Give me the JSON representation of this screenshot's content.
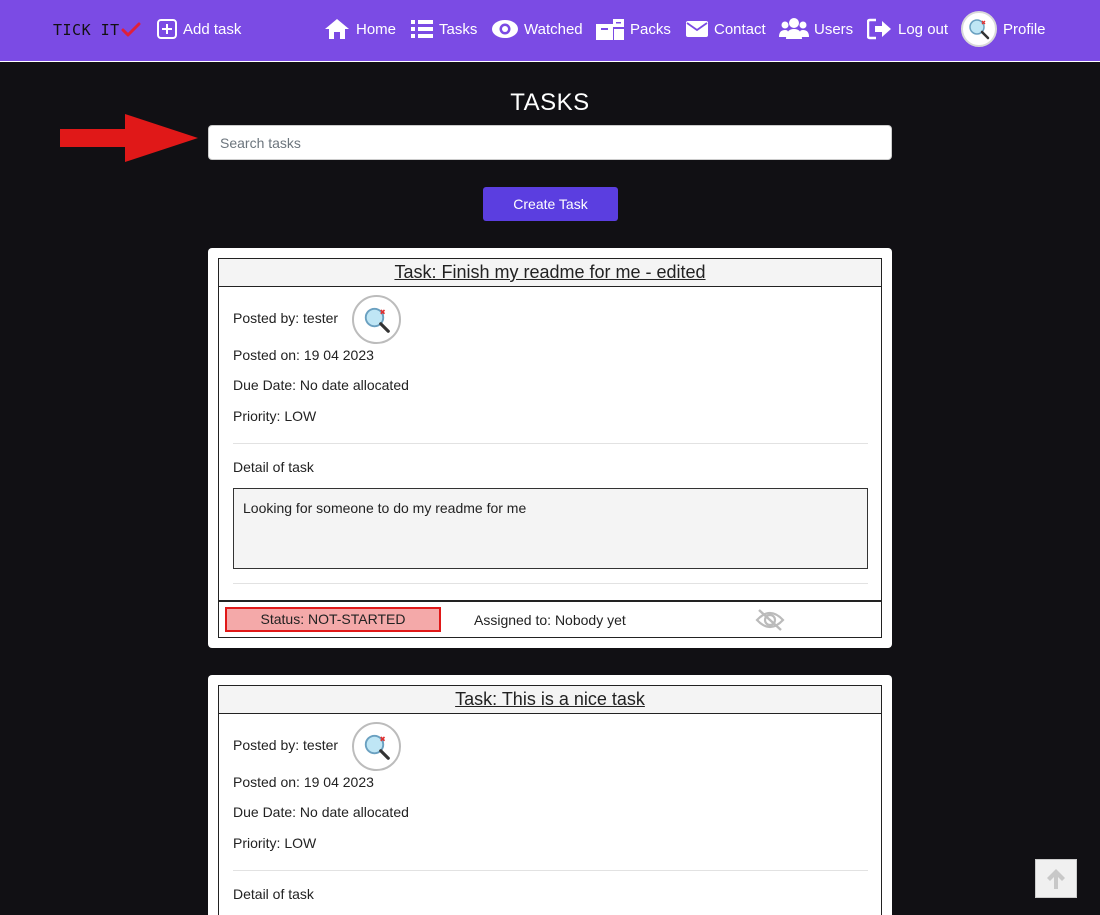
{
  "nav": {
    "brand": "TICK IT",
    "add_task": "Add task",
    "home": "Home",
    "tasks": "Tasks",
    "watched": "Watched",
    "packs": "Packs",
    "contact": "Contact",
    "users": "Users",
    "logout": "Log out",
    "profile": "Profile"
  },
  "page": {
    "title": "TASKS",
    "search_placeholder": "Search tasks",
    "create_button": "Create Task"
  },
  "tasks": [
    {
      "title": "Task: Finish my readme for me - edited",
      "posted_by": "Posted by: tester",
      "posted_on": "Posted on: 19 04 2023",
      "due_date": "Due Date: No date allocated",
      "priority": "Priority: LOW",
      "detail_label": "Detail of task",
      "detail": "Looking for someone to do my readme for me",
      "status": "Status: NOT-STARTED",
      "assigned": "Assigned to: Nobody yet"
    },
    {
      "title": "Task: This is a nice task",
      "posted_by": "Posted by: tester",
      "posted_on": "Posted on: 19 04 2023",
      "due_date": "Due Date: No date allocated",
      "priority": "Priority: LOW",
      "detail_label": "Detail of task"
    }
  ],
  "colors": {
    "navbar": "#7b4be4",
    "background": "#111014",
    "accent_button": "#5b3ee0",
    "status_bg": "#f4a9a9",
    "status_border": "#e01818",
    "arrow": "#e01818"
  },
  "icons": {
    "add_task": "plus-square-icon",
    "home": "home-icon",
    "tasks": "list-icon",
    "watched": "eye-icon",
    "packs": "boxes-icon",
    "contact": "envelope-icon",
    "users": "users-icon",
    "logout": "sign-out-icon",
    "watch_toggle": "eye-slash-icon",
    "scroll_top": "arrow-up-icon"
  }
}
